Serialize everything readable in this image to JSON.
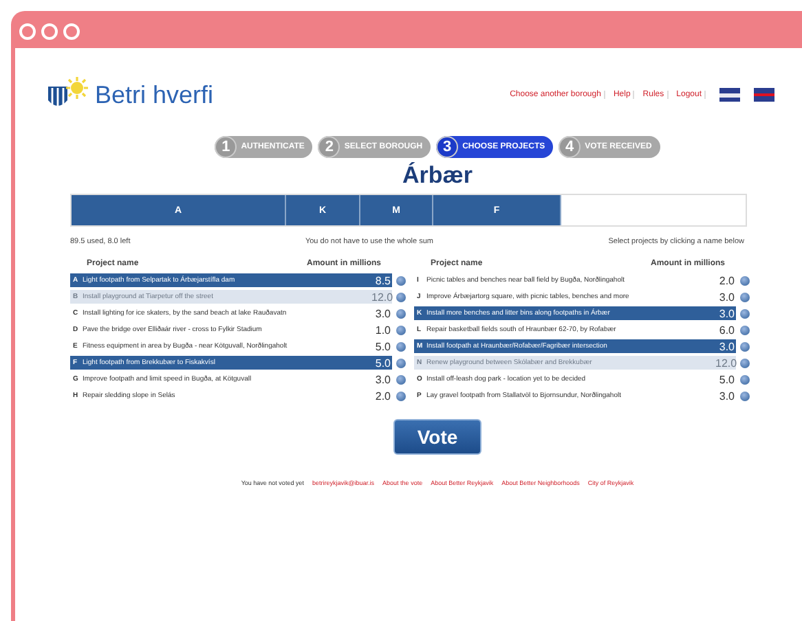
{
  "header": {
    "logo_text": "Betri hverfi",
    "links": [
      "Choose another borough",
      "Help",
      "Rules",
      "Logout"
    ]
  },
  "steps": [
    {
      "number": "1",
      "label": "AUTHENTICATE",
      "selected": false
    },
    {
      "number": "2",
      "label": "SELECT BOROUGH",
      "selected": false
    },
    {
      "number": "3",
      "label": "CHOOSE PROJECTS",
      "selected": true
    },
    {
      "number": "4",
      "label": "VOTE RECEIVED",
      "selected": false
    }
  ],
  "borough": "Árbær",
  "letter_tabs": [
    "A",
    "K",
    "M",
    "F"
  ],
  "info": {
    "used": "89.5 used, 8.0 left",
    "note": "You do not have to use the whole sum",
    "hint": "Select projects by clicking a name below"
  },
  "columns": [
    {
      "name_header": "Project name",
      "amount_header": "Amount in millions",
      "projects": [
        {
          "letter": "A",
          "name": "Light footpath from Selpartak to Árbæjarstífla dam",
          "amount": "8.5",
          "selected": true,
          "disabled": false
        },
        {
          "letter": "B",
          "name": "Install playground at Tiarpetur off the street",
          "amount": "12.0",
          "selected": false,
          "disabled": true
        },
        {
          "letter": "C",
          "name": "Install lighting for ice skaters, by the sand beach at lake Rauðavatn",
          "amount": "3.0",
          "selected": false,
          "disabled": false
        },
        {
          "letter": "D",
          "name": "Pave the bridge over Elliðaár river - cross to Fylkir Stadium",
          "amount": "1.0",
          "selected": false,
          "disabled": false
        },
        {
          "letter": "E",
          "name": "Fitness equipment in area by Bugða - near Kötguvall, Norðlingaholt",
          "amount": "5.0",
          "selected": false,
          "disabled": false
        },
        {
          "letter": "F",
          "name": "Light footpath from Brekkubær to Fiskakvísl",
          "amount": "5.0",
          "selected": true,
          "disabled": false
        },
        {
          "letter": "G",
          "name": "Improve footpath and limit speed in Bugða, at Kötguvall",
          "amount": "3.0",
          "selected": false,
          "disabled": false
        },
        {
          "letter": "H",
          "name": "Repair sledding slope in Selás",
          "amount": "2.0",
          "selected": false,
          "disabled": false
        }
      ]
    },
    {
      "name_header": "Project name",
      "amount_header": "Amount in millions",
      "projects": [
        {
          "letter": "I",
          "name": "Picnic tables and benches near ball field by Bugða, Norðlingaholt",
          "amount": "2.0",
          "selected": false,
          "disabled": false
        },
        {
          "letter": "J",
          "name": "Improve Árbæjartorg square, with picnic tables, benches and more",
          "amount": "3.0",
          "selected": false,
          "disabled": false
        },
        {
          "letter": "K",
          "name": "Install more benches and litter bins along footpaths in Árbær",
          "amount": "3.0",
          "selected": true,
          "disabled": false
        },
        {
          "letter": "L",
          "name": "Repair basketball fields south of Hraunbær 62-70, by Rofabær",
          "amount": "6.0",
          "selected": false,
          "disabled": false
        },
        {
          "letter": "M",
          "name": "Install footpath at Hraunbær/Rofabær/Fagribær intersection",
          "amount": "3.0",
          "selected": true,
          "disabled": false
        },
        {
          "letter": "N",
          "name": "Renew playground between Skólabær and Brekkubær",
          "amount": "12.0",
          "selected": false,
          "disabled": true
        },
        {
          "letter": "O",
          "name": "Install off-leash dog park - location yet to be decided",
          "amount": "5.0",
          "selected": false,
          "disabled": false
        },
        {
          "letter": "P",
          "name": "Lay gravel footpath from Stallatvöl to Bjornsundur, Norðlingaholt",
          "amount": "3.0",
          "selected": false,
          "disabled": false
        }
      ]
    }
  ],
  "vote_button": "Vote",
  "footer": {
    "status": "You have not voted yet",
    "links": [
      "betrireykjavik@ibuar.is",
      "About the vote",
      "About Better Reykjavik",
      "About Better Neighborhoods",
      "City of Reykjavik"
    ]
  }
}
